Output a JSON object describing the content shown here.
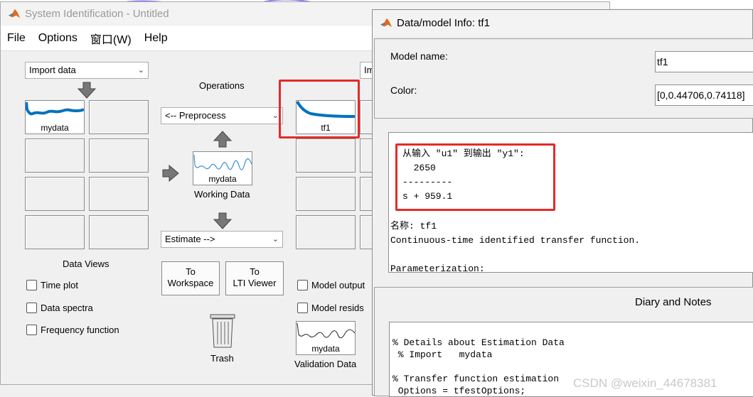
{
  "main_window": {
    "title": "System Identification - Untitled",
    "menu": [
      "File",
      "Options",
      "窗口(W)",
      "Help"
    ],
    "import_data_select": "Import data",
    "import_models_select": "Im",
    "data_tiles": [
      {
        "label": "mydata"
      }
    ],
    "model_tiles": [
      {
        "label": "tf1"
      }
    ],
    "operations_label": "Operations",
    "preprocess_select": "<-- Preprocess",
    "working_data": {
      "tile_label": "mydata",
      "caption": "Working Data"
    },
    "estimate_select": "Estimate -->",
    "to_workspace_button": [
      "To",
      "Workspace"
    ],
    "to_lti_viewer_button": [
      "To",
      "LTI Viewer"
    ],
    "trash_label": "Trash",
    "data_views_label": "Data Views",
    "data_views": [
      "Time plot",
      "Data spectra",
      "Frequency function"
    ],
    "model_views": [
      "Model output",
      "Model resids"
    ],
    "validation_data": {
      "tile_label": "mydata",
      "caption": "Validation Data"
    }
  },
  "info_window": {
    "title": "Data/model Info: tf1",
    "model_name_label": "Model name:",
    "model_name_value": "tf1",
    "color_label": "Color:",
    "color_value": "[0,0.44706,0.74118]",
    "info_lines": [
      "从输入 \"u1\" 到输出 \"y1\":",
      "  2650",
      "---------",
      "s + 959.1"
    ],
    "info_after": [
      "名称: tf1",
      "Continuous-time identified transfer function.",
      "",
      "Parameterization:"
    ],
    "diary_title": "Diary and Notes",
    "diary_lines": [
      "% Details about Estimation Data",
      " % Import   mydata",
      "",
      "% Transfer function estimation",
      " Options = tfestOptions;"
    ]
  },
  "watermark": "CSDN @weixin_44678381",
  "colors": {
    "curve": "#0072bd",
    "highlight": "#e52a2a",
    "background_stroke": "#6a3df0"
  }
}
